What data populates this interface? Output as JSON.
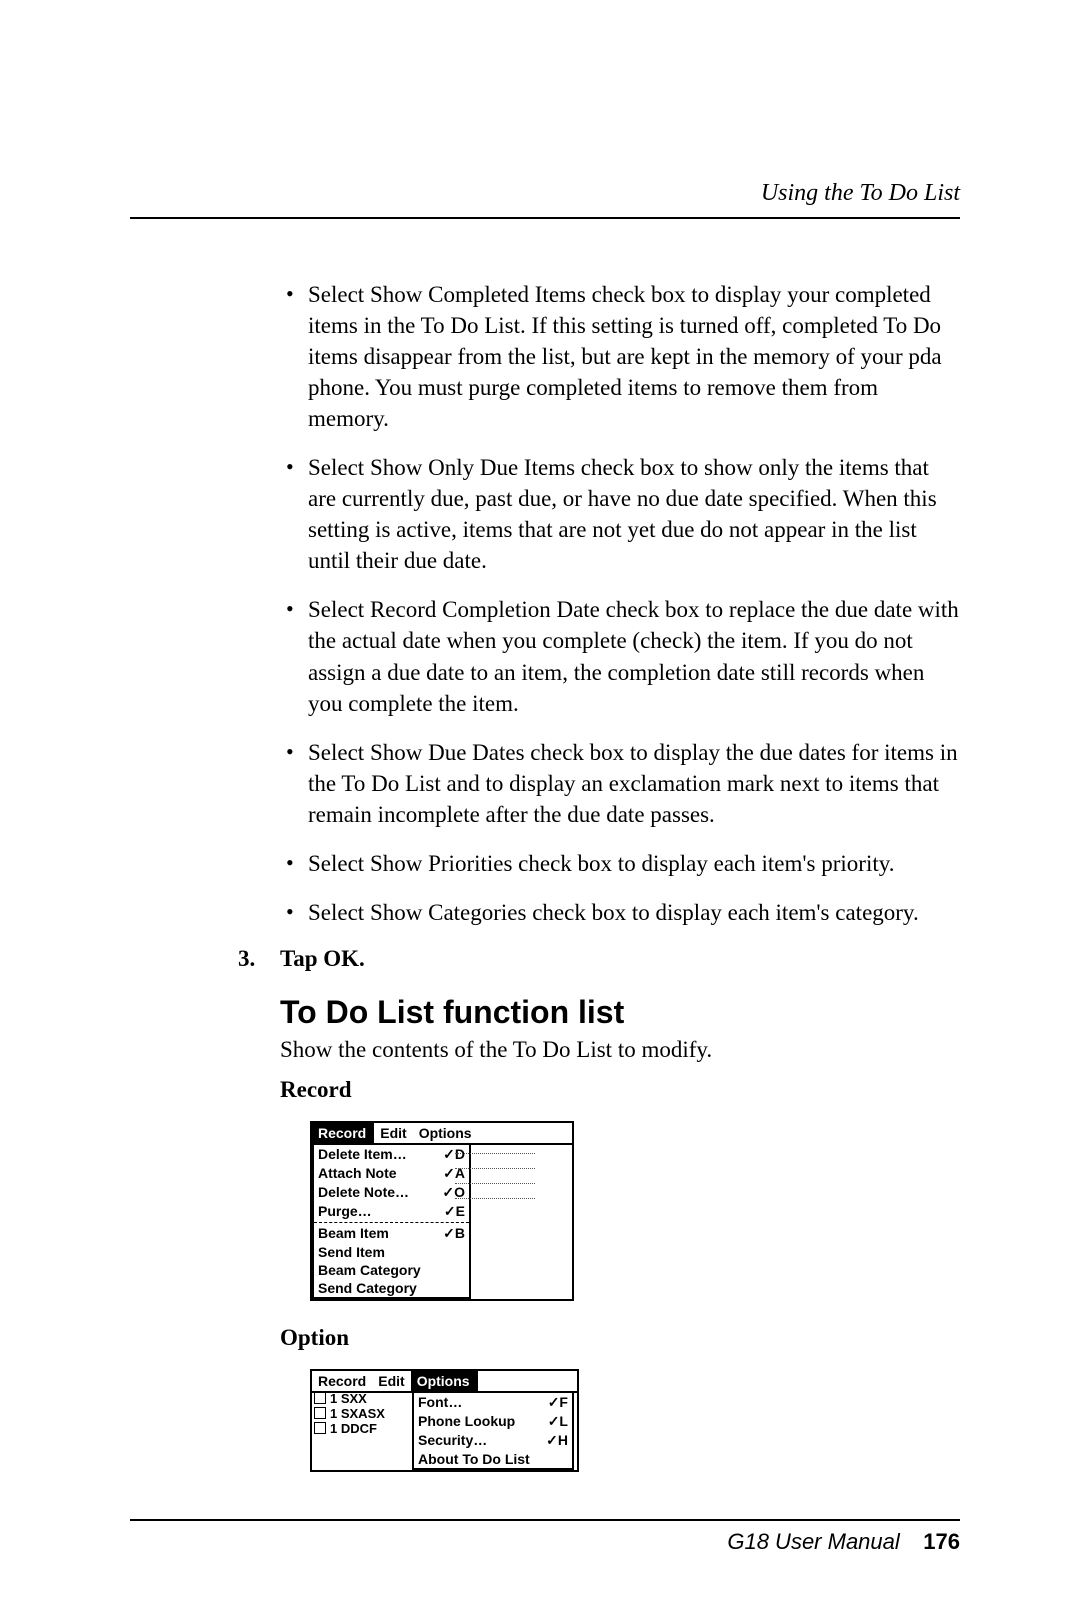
{
  "header": {
    "running": "Using the To Do List"
  },
  "bullets": [
    "Select Show Completed Items check box to display your completed items in the To Do List. If this setting is turned off, completed To Do items disappear from the list, but are kept in the memory of your pda phone. You must purge completed items to remove them from memory.",
    "Select Show Only Due Items check box to show only the items that are currently due, past due, or have no due date specified. When this setting is active, items that are not yet due do not appear in the list until their due date.",
    "Select Record Completion Date check box to replace the due date with the actual date when you complete (check) the item. If you do not assign a due date to an item, the completion date still records when you complete the item.",
    "Select Show Due Dates check box to display the due dates for items in the To Do List and to display an exclamation mark next to items that remain incomplete after the due date passes.",
    "Select Show Priorities check box to display each item's priority.",
    "Select Show Categories check box to display each item's category."
  ],
  "step": {
    "num": "3.",
    "text": "Tap OK."
  },
  "section_title": "To Do List function list",
  "section_lead": "Show the contents of the To Do List to modify.",
  "record": {
    "label": "Record",
    "menubar": [
      "Record",
      "Edit",
      "Options"
    ],
    "active_index": 0,
    "items_top": [
      {
        "label": "Delete Item…",
        "accel": "✓D"
      },
      {
        "label": "Attach Note",
        "accel": "✓A"
      },
      {
        "label": "Delete Note…",
        "accel": "✓O"
      },
      {
        "label": "Purge…",
        "accel": "✓E"
      }
    ],
    "items_bottom": [
      {
        "label": "Beam Item",
        "accel": "✓B"
      },
      {
        "label": "Send Item",
        "accel": ""
      },
      {
        "label": "Beam Category",
        "accel": ""
      },
      {
        "label": "Send Category",
        "accel": ""
      }
    ]
  },
  "option": {
    "label": "Option",
    "menubar": [
      "Record",
      "Edit",
      "Options"
    ],
    "active_index": 2,
    "left_rows": [
      "1 SXX",
      "1 SXASX",
      "1 DDCF"
    ],
    "items": [
      {
        "label": "Font…",
        "accel": "✓F"
      },
      {
        "label": "Phone Lookup",
        "accel": "✓L"
      },
      {
        "label": "Security…",
        "accel": "✓H"
      },
      {
        "label": "About To Do List",
        "accel": ""
      }
    ]
  },
  "footer": {
    "manual": "G18 User Manual",
    "page": "176"
  }
}
